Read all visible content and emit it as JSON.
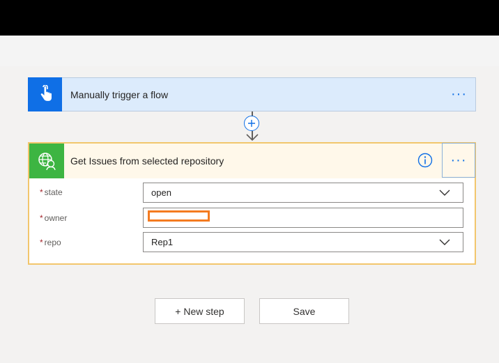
{
  "trigger": {
    "title": "Manually trigger a flow",
    "icon": "touch-hand-icon",
    "more": "···"
  },
  "connector": {
    "icon": "add-step-plus-icon"
  },
  "action": {
    "title": "Get Issues from selected repository",
    "icon": "globe-user-icon",
    "info_icon": "info-icon",
    "more": "···",
    "fields": [
      {
        "required_mark": "*",
        "label": "state",
        "value": "open",
        "type": "dropdown"
      },
      {
        "required_mark": "*",
        "label": "owner",
        "value": "",
        "type": "text",
        "redacted": true
      },
      {
        "required_mark": "*",
        "label": "repo",
        "value": "Rep1",
        "type": "dropdown"
      }
    ]
  },
  "footer": {
    "new_step_label": "+ New step",
    "save_label": "Save"
  },
  "colors": {
    "trigger_accent": "#0f6fe6",
    "action_accent": "#3db542",
    "action_border": "#f2c66c",
    "redaction": "#f47b20"
  }
}
